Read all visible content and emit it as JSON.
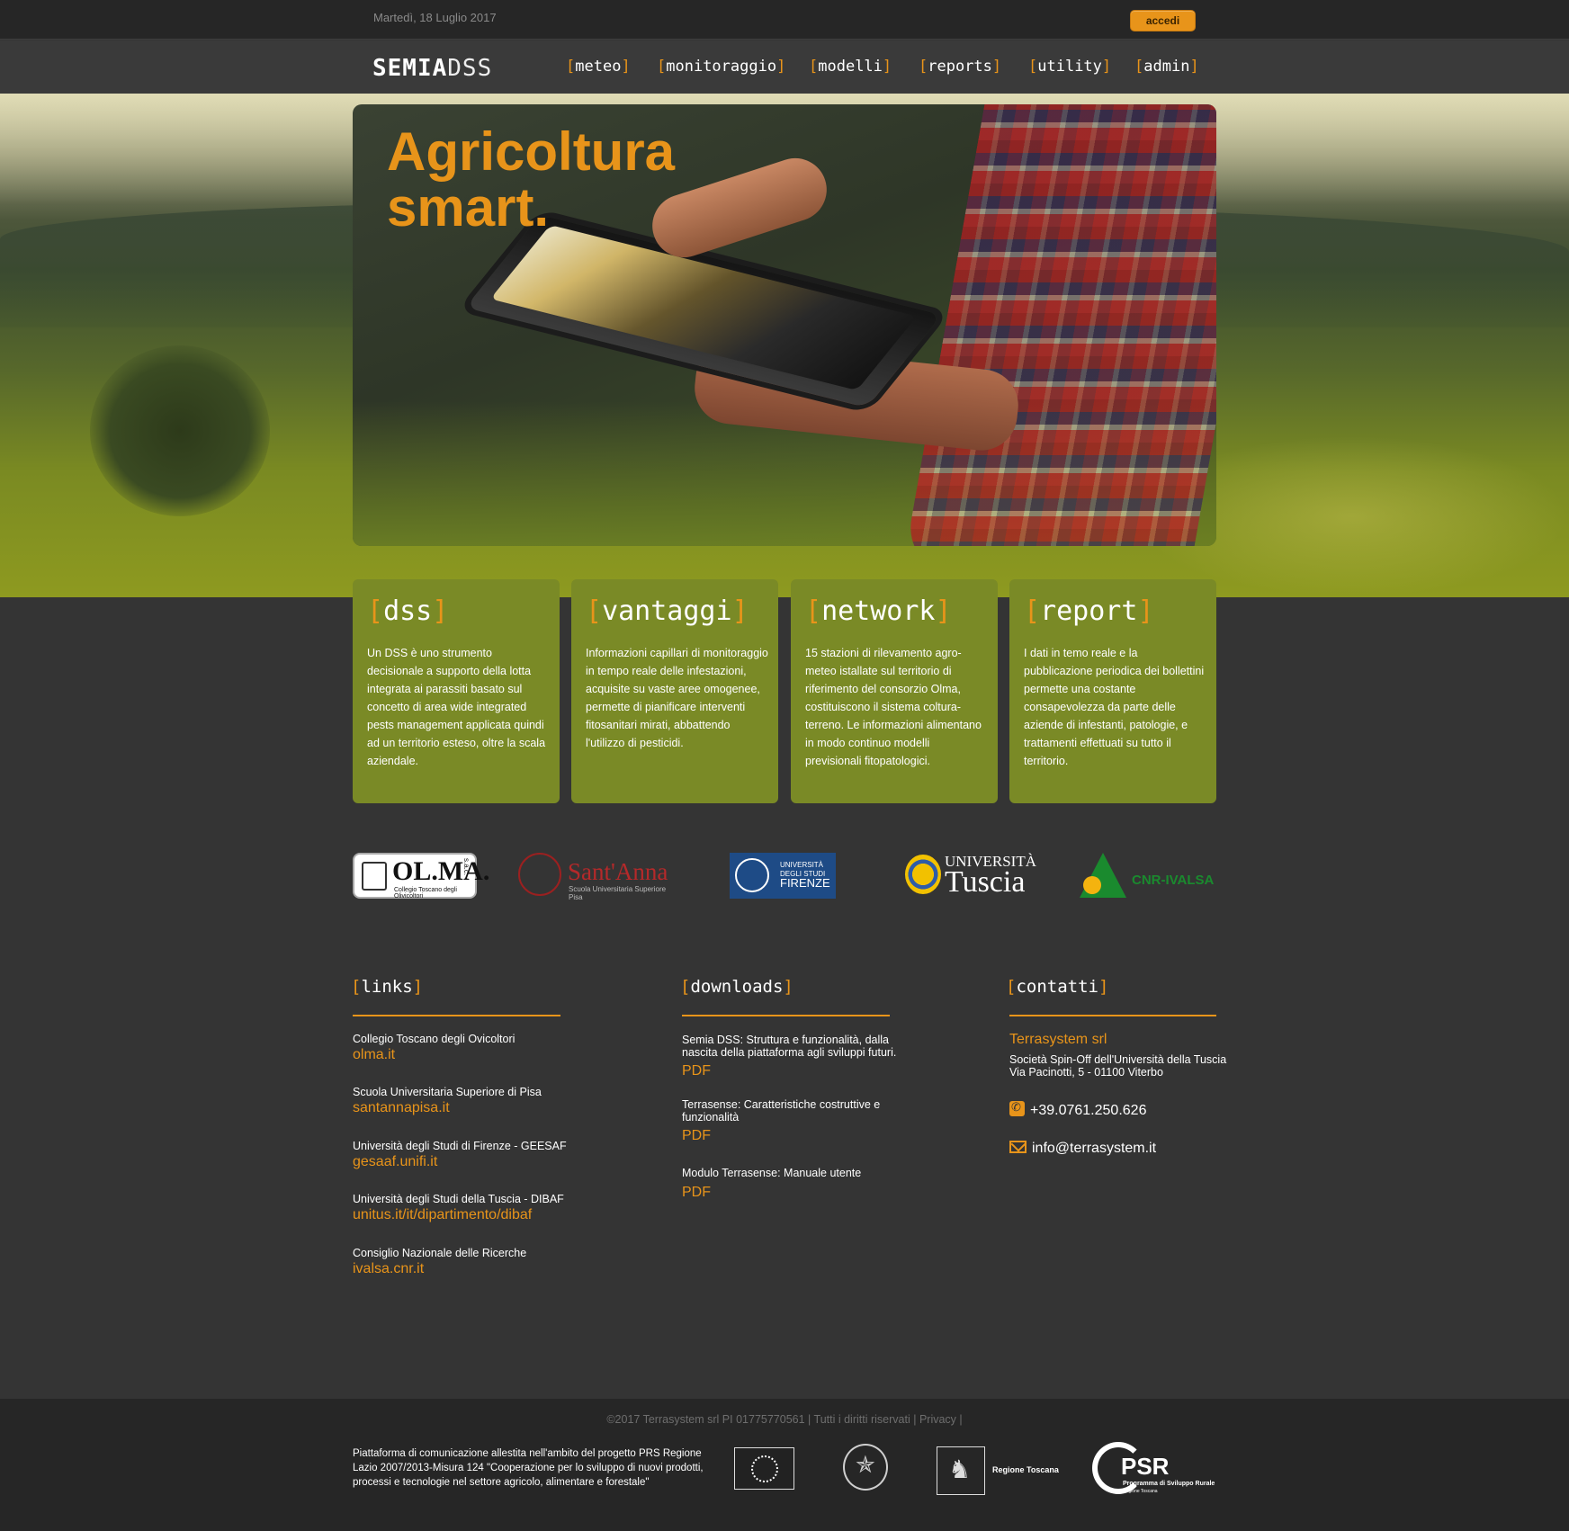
{
  "topbar": {
    "date": "Martedì, 18 Luglio 2017",
    "login_label": "accedi"
  },
  "brand": {
    "bold": "SEMIA",
    "light": "DSS"
  },
  "nav": [
    "meteo",
    "monitoraggio",
    "modelli",
    "reports",
    "utility",
    "admin"
  ],
  "hero": {
    "line1": "Agricoltura",
    "line2": "smart."
  },
  "cards": [
    {
      "title": "dss",
      "text": "Un DSS è uno strumento decisionale a supporto della lotta integrata ai parassiti basato sul concetto di area wide integrated pests management applicata quindi ad un territorio esteso, oltre la scala aziendale."
    },
    {
      "title": "vantaggi",
      "text": "Informazioni capillari di monitoraggio in tempo reale delle infestazioni, acquisite su vaste aree omogenee, permette di pianificare interventi fitosanitari mirati, abbattendo l'utilizzo di pesticidi."
    },
    {
      "title": "network",
      "text": "15 stazioni di rilevamento agro-meteo istallate sul territorio di riferimento del consorzio Olma, costituiscono il sistema coltura-terreno. Le informazioni alimentano in modo continuo modelli previsionali fitopatologici."
    },
    {
      "title": "report",
      "text": "I dati in temo reale e la pubblicazione periodica dei bollettini permette una costante consapevolezza da parte delle aziende di infestanti, patologie, e trattamenti effettuati su tutto il territorio."
    }
  ],
  "partners": {
    "olma": {
      "name": "OL.MA.",
      "suffix": "s.a.c.",
      "subtitle": "Collegio Toscano degli Olivicoltori"
    },
    "santanna": {
      "name": "Sant'Anna",
      "subtitle": "Scuola Universitaria Superiore Pisa"
    },
    "firenze": {
      "line1": "UNIVERSITÀ",
      "line2": "DEGLI STUDI",
      "line3": "FIRENZE"
    },
    "tuscia": {
      "line1": "UNIVERSITÀ",
      "line2": "Tuscia"
    },
    "cnr": {
      "name": "CNR-IVALSA"
    }
  },
  "footer": {
    "links_title": "links",
    "links": [
      {
        "label": "Collegio Toscano degli Ovicoltori",
        "url": "olma.it"
      },
      {
        "label": "Scuola Universitaria Superiore di Pisa",
        "url": "santannapisa.it"
      },
      {
        "label": "Università degli Studi di  Firenze - GEESAF",
        "url": "gesaaf.unifi.it"
      },
      {
        "label": "Università degli Studi della Tuscia - DIBAF",
        "url": "unitus.it/it/dipartimento/dibaf"
      },
      {
        "label": "Consiglio Nazionale delle Ricerche",
        "url": "ivalsa.cnr.it"
      }
    ],
    "downloads_title": "downloads",
    "downloads": [
      {
        "label": "Semia DSS: Struttura e funzionalità, dalla nascita della piattaforma agli sviluppi futuri.",
        "link": "PDF"
      },
      {
        "label": "Terrasense: Caratteristiche costruttive e funzionalità",
        "link": "PDF"
      },
      {
        "label": "Modulo Terrasense: Manuale utente",
        "link": "PDF"
      }
    ],
    "contacts_title": "contatti",
    "contacts": {
      "company": "Terrasystem srl",
      "line1": "Società Spin-Off dell'Università della Tuscia",
      "line2": "Via Pacinotti, 5 - 01100 Viterbo",
      "phone": "+39.0761.250.626",
      "email": "info@terrasystem.it"
    }
  },
  "bottom": {
    "copyright": "©2017 Terrasystem srl PI 01775770561 | Tutti i diritti riservati |",
    "privacy": "Privacy",
    "sep": "|",
    "disclaimer": "Piattaforma di comunicazione allestita nell'ambito del progetto PRS Regione Lazio 2007/2013-Misura 124 \"Cooperazione per lo sviluppo di nuovi prodotti, processi e tecnologie nel settore agricolo, alimentare e forestale\"",
    "toscana": "Regione Toscana",
    "psr": "PSR",
    "psr_sub": "Programma di Sviluppo Rurale",
    "psr_sub2": "Regione Toscana"
  },
  "colors": {
    "accent": "#e8941a",
    "card_bg": "#7a8a26",
    "page_bg": "#343434"
  }
}
